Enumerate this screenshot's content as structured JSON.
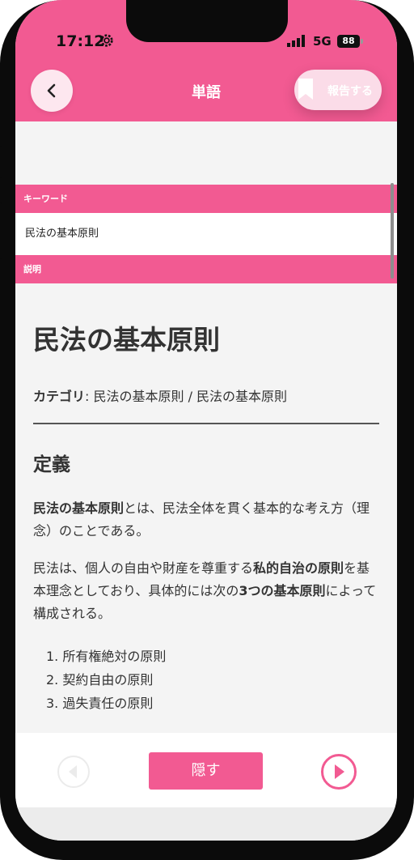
{
  "status": {
    "time": "17:12",
    "network": "5G",
    "battery": "88"
  },
  "header": {
    "title": "単語",
    "report_label": "報告する"
  },
  "sections": {
    "keyword_header": "キーワード",
    "keyword_value": "民法の基本原則",
    "description_header": "説明"
  },
  "article": {
    "title": "民法の基本原則",
    "category_label": "カテゴリ",
    "category_value": ": 民法の基本原則 / 民法の基本原則",
    "definition_heading": "定義",
    "p1_bold": "民法の基本原則",
    "p1_rest": "とは、民法全体を貫く基本的な考え方（理念）のことである。",
    "p2_a": "民法は、個人の自由や財産を尊重する",
    "p2_bold1": "私的自治の原則",
    "p2_b": "を基本理念としており、具体的には次の",
    "p2_bold2": "3つの基本原則",
    "p2_c": "によって構成される。",
    "list": [
      "1.  所有権絶対の原則",
      "2.  契約自由の原則",
      "3.  過失責任の原則"
    ]
  },
  "footer": {
    "hide_label": "隠す"
  },
  "colors": {
    "accent": "#f25a92",
    "background": "#f4f4f4"
  },
  "icons": [
    "gear-icon",
    "signal-icon",
    "battery-icon",
    "back-icon",
    "bookmark-icon",
    "prev-icon",
    "next-icon"
  ]
}
